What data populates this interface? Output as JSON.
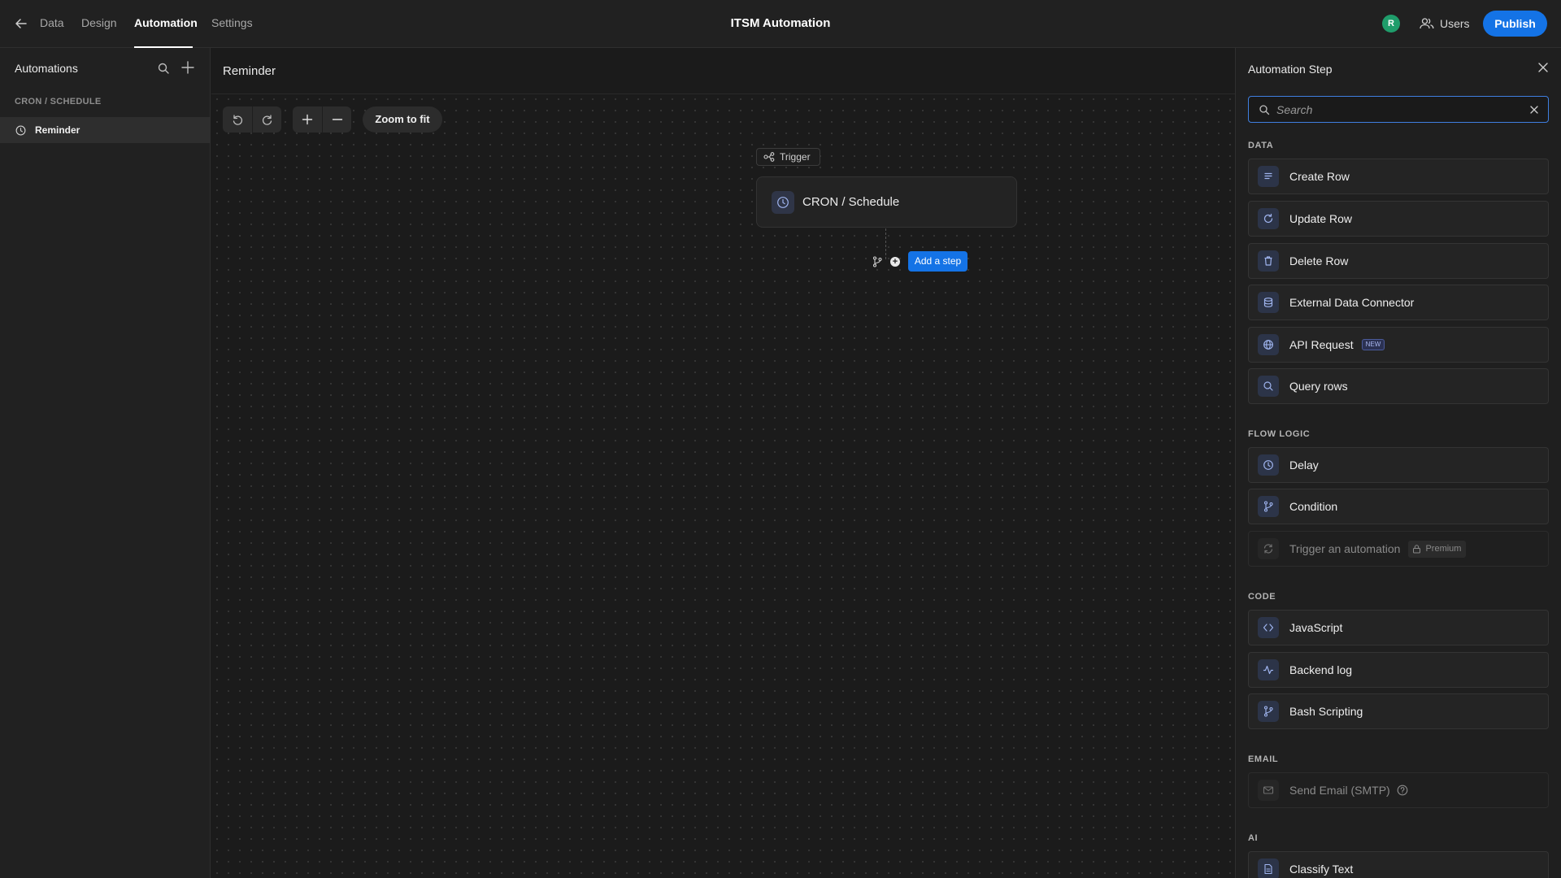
{
  "topbar": {
    "tabs": [
      {
        "label": "Data",
        "active": false
      },
      {
        "label": "Design",
        "active": false
      },
      {
        "label": "Automation",
        "active": true
      },
      {
        "label": "Settings",
        "active": false
      }
    ],
    "app_title": "ITSM Automation",
    "avatar_initial": "R",
    "users_label": "Users",
    "publish_label": "Publish",
    "accent_color": "#1473e6"
  },
  "sidebar": {
    "title": "Automations",
    "section": "CRON / SCHEDULE",
    "items": [
      {
        "label": "Reminder",
        "icon": "clock-icon",
        "selected": true
      }
    ]
  },
  "canvas": {
    "title": "Reminder",
    "zoom_label": "Zoom to fit",
    "trigger_tag": "Trigger",
    "trigger_card": "CRON / Schedule",
    "add_step_label": "Add a step"
  },
  "panel": {
    "title": "Automation Step",
    "search_placeholder": "Search",
    "sections": {
      "data": "DATA",
      "flow": "FLOW LOGIC",
      "code": "CODE",
      "email": "EMAIL",
      "ai": "AI"
    },
    "data_steps": [
      {
        "label": "Create Row",
        "icon": "create-row-icon"
      },
      {
        "label": "Update Row",
        "icon": "refresh-icon"
      },
      {
        "label": "Delete Row",
        "icon": "trash-icon"
      },
      {
        "label": "External Data Connector",
        "icon": "database-icon"
      },
      {
        "label": "API Request",
        "icon": "globe-icon",
        "badge": "NEW"
      },
      {
        "label": "Query rows",
        "icon": "search-icon"
      }
    ],
    "flow_steps": [
      {
        "label": "Delay",
        "icon": "clock-icon"
      },
      {
        "label": "Condition",
        "icon": "branch-icon"
      },
      {
        "label": "Trigger an automation",
        "icon": "refresh-icon",
        "disabled": true,
        "badge": "Premium"
      }
    ],
    "code_steps": [
      {
        "label": "JavaScript",
        "icon": "code-icon"
      },
      {
        "label": "Backend log",
        "icon": "activity-icon"
      },
      {
        "label": "Bash Scripting",
        "icon": "branch-icon"
      }
    ],
    "email_steps": [
      {
        "label": "Send Email (SMTP)",
        "icon": "mail-icon",
        "disabled": true
      }
    ],
    "ai_steps": [
      {
        "label": "Classify Text",
        "icon": "document-icon"
      }
    ]
  }
}
